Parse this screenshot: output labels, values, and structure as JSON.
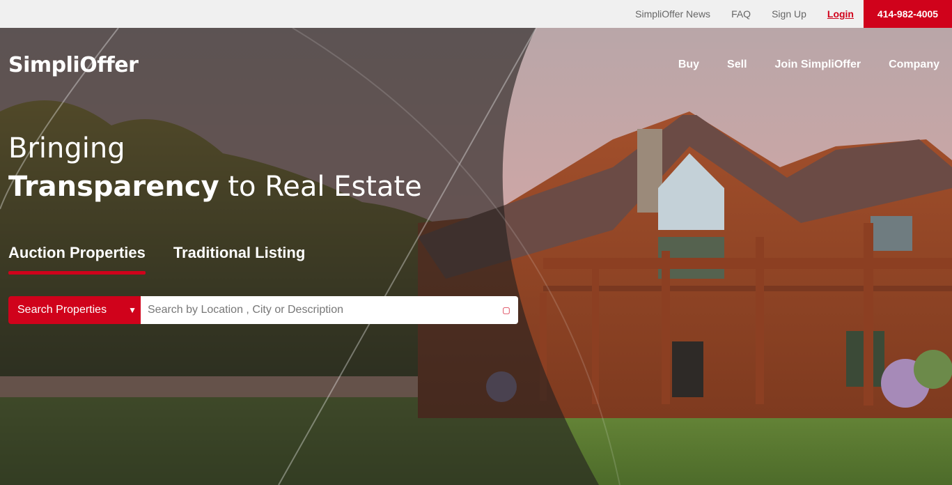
{
  "topbar": {
    "links": [
      "SimpliOffer News",
      "FAQ",
      "Sign Up"
    ],
    "login": "Login",
    "phone": "414-982-4005"
  },
  "brand": {
    "logo_text": "SimpliOffer",
    "accent": "#d0021b"
  },
  "nav": {
    "items": [
      "Buy",
      "Sell",
      "Join SimpliOffer",
      "Company"
    ]
  },
  "hero": {
    "line1": "Bringing",
    "line2_bold": "Transparency",
    "line2_rest": " to Real Estate"
  },
  "tabs": {
    "items": [
      "Auction Properties",
      "Traditional Listing"
    ],
    "active": 0
  },
  "search": {
    "select_value": "Search Properties",
    "placeholder": "Search by Location , City or Description",
    "value": ""
  },
  "icons": {
    "search": "search-icon",
    "select": "chevron-down-icon"
  }
}
